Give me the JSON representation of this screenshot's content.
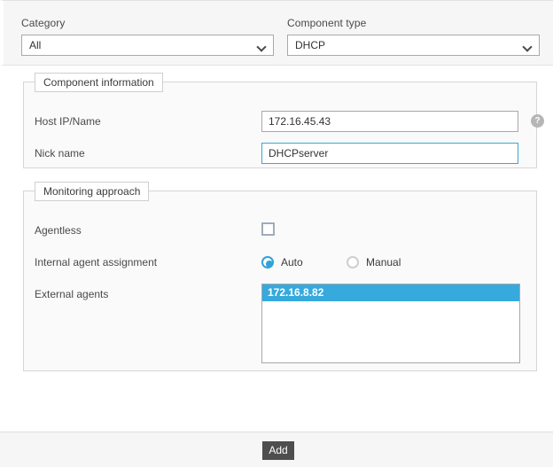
{
  "topbar": {
    "category": {
      "label": "Category",
      "value": "All",
      "chevron_icon": "chevron-down-icon"
    },
    "component_type": {
      "label": "Component type",
      "value": "DHCP",
      "chevron_icon": "chevron-down-icon"
    }
  },
  "component_information": {
    "legend": "Component information",
    "host": {
      "label": "Host IP/Name",
      "value": "172.16.45.43",
      "help_icon": "?"
    },
    "nickname": {
      "label": "Nick name",
      "value": "DHCPserver"
    }
  },
  "monitoring_approach": {
    "legend": "Monitoring approach",
    "agentless": {
      "label": "Agentless",
      "checked": false
    },
    "internal_agent_assignment": {
      "label": "Internal agent assignment",
      "options": [
        {
          "label": "Auto",
          "selected": true
        },
        {
          "label": "Manual",
          "selected": false
        }
      ]
    },
    "external_agents": {
      "label": "External agents",
      "items": [
        {
          "value": "172.16.8.82",
          "selected": true
        }
      ]
    }
  },
  "footer": {
    "add_label": "Add"
  },
  "colors": {
    "accent": "#36a9dd",
    "focus_border": "#39a7d4",
    "button_bg": "#4e4e4e",
    "panel_bg": "#fafafa",
    "bar_bg": "#f6f6f6"
  }
}
